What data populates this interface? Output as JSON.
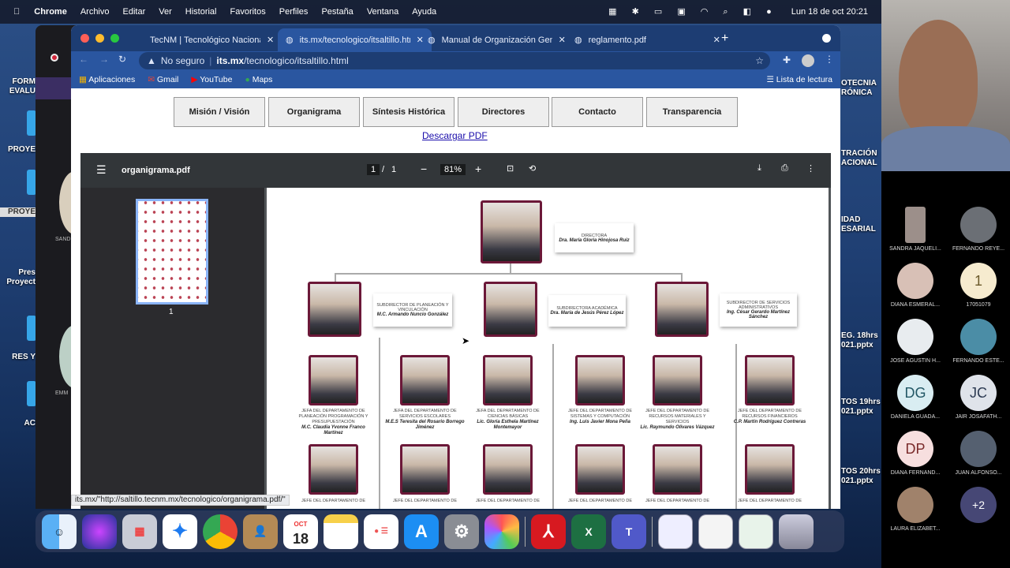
{
  "menubar": {
    "app": "Chrome",
    "items": [
      "Archivo",
      "Editar",
      "Ver",
      "Historial",
      "Favoritos",
      "Perfiles",
      "Pestaña",
      "Ventana",
      "Ayuda"
    ],
    "clock": "Lun 18 de oct  20:21"
  },
  "desktop_left": [
    "FORM EVALU",
    "PROYE",
    "PROYE",
    "Pres Proyect",
    "RES Y",
    "AC"
  ],
  "desktop_right": [
    "OTECNIA RÓNICA",
    "TRACIÓN ACIONAL",
    "IDAD ESARIAL",
    "EG. 18hrs 021.pptx",
    "TOS 19hrs 021.pptx",
    "TOS 20hrs 021.pptx"
  ],
  "teams_bg": [
    "SAND",
    "EMM"
  ],
  "tabs": [
    {
      "title": "TecNM | Tecnológico Nacional"
    },
    {
      "title": "its.mx/tecnologico/itsaltillo.htm"
    },
    {
      "title": "Manual de Organización Gener"
    },
    {
      "title": "reglamento.pdf"
    }
  ],
  "address": {
    "warning": "No seguro",
    "host": "its.mx",
    "path": "/tecnologico/itsaltillo.html"
  },
  "bookmarks": [
    "Aplicaciones",
    "Gmail",
    "YouTube",
    "Maps"
  ],
  "reading_list": "Lista de lectura",
  "nav": [
    "Misión / Visión",
    "Organigrama",
    "Síntesis Histórica",
    "Directores",
    "Contacto",
    "Transparencia"
  ],
  "download_link": "Descargar PDF",
  "pdf": {
    "filename": "organigrama.pdf",
    "page": "1",
    "sep": "/",
    "total": "1",
    "zoom": "81%",
    "thumb_label": "1"
  },
  "org": {
    "director": {
      "title": "DIRECTORA",
      "name": "Dra. María Gloria Hinojosa Ruiz"
    },
    "subdirectors": [
      {
        "title": "SUBDIRECTOR DE PLANEACIÓN Y VINCULACIÓN",
        "name": "M.C. Armando Nuncio González"
      },
      {
        "title": "SUBDIRECTORA ACADÉMICA",
        "name": "Dra. María de Jesús Pérez López"
      },
      {
        "title": "SUBDIRECTOR DE SERVICIOS ADMINISTRATIVOS",
        "name": "Ing. César Gerardo Martínez Sánchez"
      }
    ],
    "heads": [
      {
        "title": "JEFA DEL DEPARTAMENTO DE PLANEACIÓN PROGRAMACIÓN Y PRESUPUESTACIÓN",
        "name": "M.C. Claudia Yvonne Franco Martínez"
      },
      {
        "title": "JEFA DEL DEPARTAMENTO DE SERVICIOS ESCOLARES",
        "name": "M.E.S Teresita del Rosario Borrego Jiménez"
      },
      {
        "title": "JEFA DEL DEPARTAMENTO DE CIENCIAS BÁSICAS",
        "name": "Lic. Gloria Esthela Martínez Montemayor"
      },
      {
        "title": "JEFE DEL DEPARTAMENTO DE SISTEMAS Y COMPUTACIÓN",
        "name": "Ing. Luis Javier Mona Peña"
      },
      {
        "title": "JEFE DEL DEPARTAMENTO DE RECURSOS MATERIALES Y SERVICIOS",
        "name": "Lic. Raymundo Olivares Vázquez"
      },
      {
        "title": "JEFE DEL DEPARTAMENTO DE RECURSOS FINANCIEROS",
        "name": "C.P. Martín Rodríguez Contreras"
      }
    ],
    "row4_title": "JEFE DEL DEPARTAMENTO DE"
  },
  "status_url": "its.mx/\"http://saltillo.tecnm.mx/tecnologico/organigrama.pdf/\"",
  "dock": {
    "calendar_month": "OCT",
    "calendar_day": "18"
  },
  "participants": [
    {
      "name": "SANDRA JAQUELI...",
      "initials": ""
    },
    {
      "name": "FERNANDO REYE...",
      "initials": ""
    },
    {
      "name": "DIANA ESMERAL...",
      "initials": ""
    },
    {
      "name": "17051079",
      "initials": "1"
    },
    {
      "name": "JOSE AGUSTIN H...",
      "initials": ""
    },
    {
      "name": "FERNANDO ESTE...",
      "initials": ""
    },
    {
      "name": "DANIELA GUADA...",
      "initials": "DG"
    },
    {
      "name": "JAIR JOSAFATH...",
      "initials": "JC"
    },
    {
      "name": "DIANA FERNAND...",
      "initials": "DP"
    },
    {
      "name": "JUAN ALFONSO...",
      "initials": ""
    },
    {
      "name": "LAURA ELIZABET...",
      "initials": ""
    },
    {
      "name": "",
      "initials": "+2"
    }
  ],
  "colors": {
    "frame": "#6b1838",
    "tabbar": "#1d3d73",
    "toolbar": "#2a56a0",
    "link": "#1a0dab"
  }
}
